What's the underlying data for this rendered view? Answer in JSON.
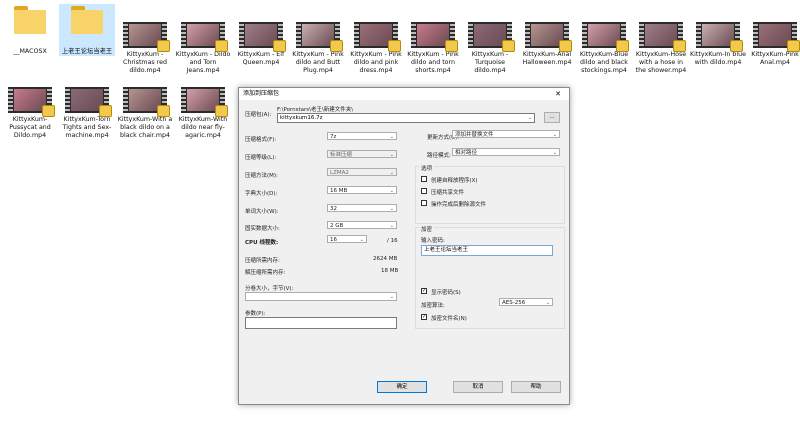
{
  "files": [
    {
      "name": "__MACOSX",
      "kind": "folder"
    },
    {
      "name": "上老王论坛当老王",
      "kind": "folder",
      "selected": true
    },
    {
      "name": "KittyxKum - Christmas red dildo.mp4",
      "kind": "video"
    },
    {
      "name": "KittyxKum - Dildo and Torn Jeans.mp4",
      "kind": "video"
    },
    {
      "name": "KittyxKum - Elf Queen.mp4",
      "kind": "video"
    },
    {
      "name": "KittyxKum - Pink dildo and Butt Plug.mp4",
      "kind": "video"
    },
    {
      "name": "KittyxKum - Pink dildo and pink dress.mp4",
      "kind": "video"
    },
    {
      "name": "KittyxKum - Pink dildo and torn shorts.mp4",
      "kind": "video"
    },
    {
      "name": "KittyxKum - Turquoise dildo.mp4",
      "kind": "video"
    },
    {
      "name": "KittyxKum-Anal Halloween.mp4",
      "kind": "video"
    },
    {
      "name": "KittyxKum-Blue dildo and black stockings.mp4",
      "kind": "video"
    },
    {
      "name": "KittyxKum-Hose with a hose in the shower.mp4",
      "kind": "video"
    },
    {
      "name": "KittyxKum-In blue with dildo.mp4",
      "kind": "video"
    },
    {
      "name": "KittyxKum-Pink Anal.mp4",
      "kind": "video"
    },
    {
      "name": "KittyxKum-Pussycat and Dildo.mp4",
      "kind": "video"
    },
    {
      "name": "KittyxKum-Torn Tights and Sex-machine.mp4",
      "kind": "video"
    },
    {
      "name": "KittyxKum-With a black dildo on a black chair.mp4",
      "kind": "video"
    },
    {
      "name": "KittyxKum-With dildo near fly-agaric.mp4",
      "kind": "video"
    }
  ],
  "dialog": {
    "title": "添加到压缩包",
    "close": "✕",
    "archive_label": "压缩包(A):",
    "archive_path": "F:\\Pornstars\\老王\\新建文件夹\\",
    "archive_name": "kittyxkum16.7z",
    "browse": "...",
    "left": [
      {
        "label": "压缩格式(F):",
        "value": "7z"
      },
      {
        "label": "压缩等级(L):",
        "value": "标准压缩",
        "disabled": true
      },
      {
        "label": "压缩方法(M):",
        "value": "LZMA2",
        "disabled": true
      },
      {
        "label": "字典大小(D):",
        "value": "16 MB"
      },
      {
        "label": "单词大小(W):",
        "value": "32"
      },
      {
        "label": "固实数据大小:",
        "value": "2 GB"
      }
    ],
    "cpu_label": "CPU 线程数:",
    "cpu_value": "16",
    "cpu_total": "/ 16",
    "mem_compress_label": "压缩所需内存:",
    "mem_compress_value": "2624 MB",
    "mem_decompress_label": "解压缩所需内存:",
    "mem_decompress_value": "18 MB",
    "split_label": "分卷大小，字节(V):",
    "params_label": "参数(P):",
    "update_label": "更新方式(U):",
    "update_value": "添加并替换文件",
    "path_label": "路径模式:",
    "path_value": "相对路径",
    "options_title": "选项",
    "options": [
      {
        "label": "创建自释放程序(X)",
        "checked": false
      },
      {
        "label": "压缩共享文件",
        "checked": false
      },
      {
        "label": "操作完成后删除源文件",
        "checked": false
      }
    ],
    "encrypt_title": "加密",
    "password_label": "输入密码:",
    "password_value": "上老王论坛当老王",
    "show_password": "显示密码(S)",
    "method_label": "加密算法:",
    "method_value": "AES-256",
    "encrypt_names": "加密文件名(N)",
    "ok": "确定",
    "cancel": "取消",
    "help": "帮助"
  }
}
